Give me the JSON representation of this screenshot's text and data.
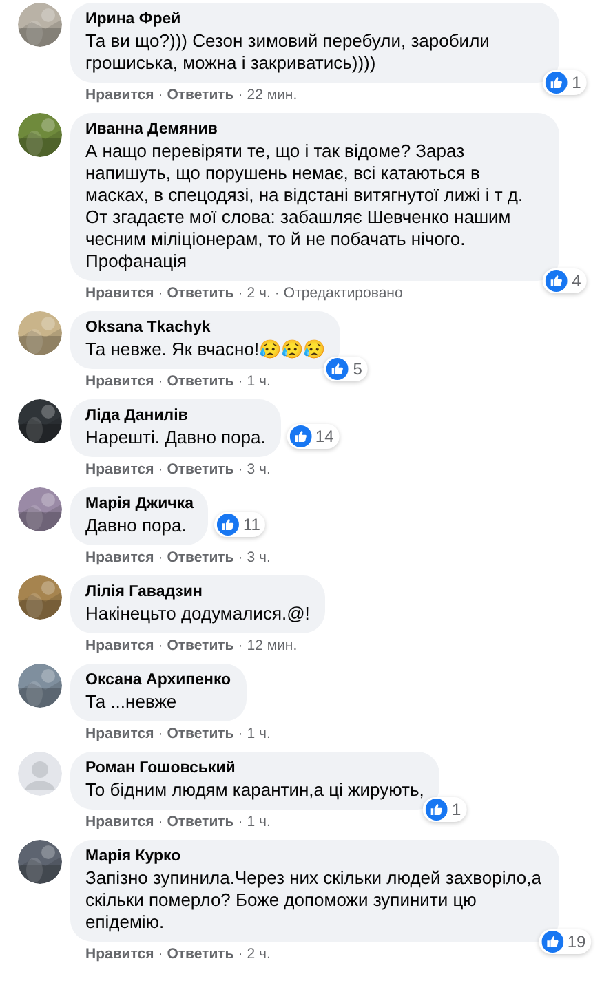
{
  "separator": "·",
  "comments": [
    {
      "author": "Ирина Фрей",
      "text": "Та ви що?))) Сезон зимовий перебули, заробили грошиська, можна і закриватись))))",
      "reaction": {
        "kind": "corner",
        "count": "1"
      },
      "like_label": "Нравится",
      "reply_label": "Ответить",
      "time": "22 мин."
    },
    {
      "author": "Иванна Демянив",
      "text": "А нащо перевіряти те, що і так відоме? Зараз напишуть, що порушень немає, всі катаються в масках, в спецодязі, на відстані витягнутої лижі і т д. От згадаєте мої слова: забашляє Шевченко нашим чесним міліціонерам, то й не побачать нічого. Профанація",
      "reaction": {
        "kind": "corner",
        "count": "4"
      },
      "like_label": "Нравится",
      "reply_label": "Ответить",
      "time": "2 ч.",
      "edited": "Отредактировано"
    },
    {
      "author": "Oksana Tkachyk",
      "text": "Та невже. Як вчасно!😥😥😥",
      "reaction": {
        "kind": "corner",
        "count": "5"
      },
      "like_label": "Нравится",
      "reply_label": "Ответить",
      "time": "1 ч."
    },
    {
      "author": "Ліда Данилів",
      "text": "Нарешті. Давно пора.",
      "reaction": {
        "kind": "side",
        "count": "14"
      },
      "like_label": "Нравится",
      "reply_label": "Ответить",
      "time": "3 ч."
    },
    {
      "author": "Марія Джичка",
      "text": "Давно пора.",
      "reaction": {
        "kind": "side",
        "count": "11"
      },
      "like_label": "Нравится",
      "reply_label": "Ответить",
      "time": "3 ч."
    },
    {
      "author": "Лілія Гавадзин",
      "text": "Накінецьто додумалися.@!",
      "like_label": "Нравится",
      "reply_label": "Ответить",
      "time": "12 мин."
    },
    {
      "author": "Оксана Архипенко",
      "text": "Та ...невже",
      "like_label": "Нравится",
      "reply_label": "Ответить",
      "time": "1 ч."
    },
    {
      "author": "Роман Гошовський",
      "avatar": {
        "kind": "silhouette"
      },
      "text": "То бідним людям карантин,а ці жирують,",
      "reaction": {
        "kind": "corner",
        "count": "1"
      },
      "like_label": "Нравится",
      "reply_label": "Ответить",
      "time": "1 ч."
    },
    {
      "author": "Марія Курко",
      "text": "Запізно зупинила.Через них скільки людей захворіло,а скільки померло? Боже допоможи зупинити цю епідемію.",
      "reaction": {
        "kind": "corner",
        "count": "19"
      },
      "like_label": "Нравится",
      "reply_label": "Ответить",
      "time": "2 ч."
    }
  ]
}
